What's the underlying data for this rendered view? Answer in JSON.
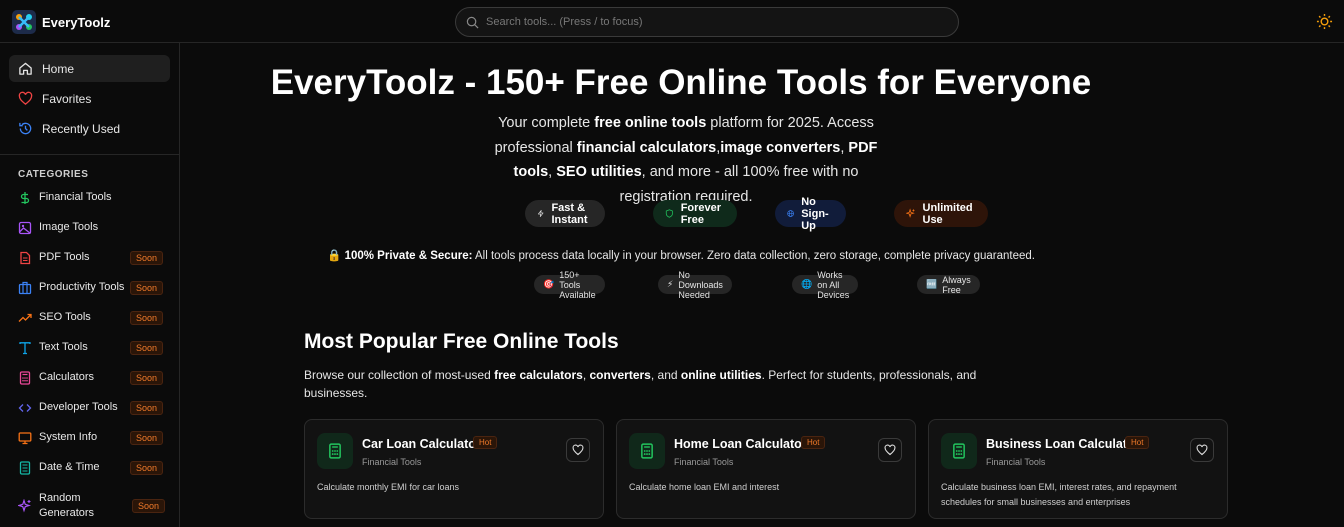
{
  "app": {
    "brand": "EveryToolz"
  },
  "search": {
    "placeholder": "Search tools... (Press / to focus)"
  },
  "sidebar": {
    "nav": [
      {
        "label": "Home",
        "icon": "home-icon"
      },
      {
        "label": "Favorites",
        "icon": "heart-icon"
      },
      {
        "label": "Recently Used",
        "icon": "history-icon"
      }
    ],
    "categories_title": "CATEGORIES",
    "soon_label": "Soon",
    "categories": [
      {
        "label": "Financial Tools",
        "icon": "dollar-icon",
        "color": "#22c55e",
        "soon": false
      },
      {
        "label": "Image Tools",
        "icon": "image-icon",
        "color": "#a855f7",
        "soon": false
      },
      {
        "label": "PDF Tools",
        "icon": "file-icon",
        "color": "#ef4444",
        "soon": true
      },
      {
        "label": "Productivity Tools",
        "icon": "briefcase-icon",
        "color": "#3b82f6",
        "soon": true
      },
      {
        "label": "SEO Tools",
        "icon": "trending-icon",
        "color": "#f97316",
        "soon": true
      },
      {
        "label": "Text Tools",
        "icon": "text-icon",
        "color": "#0ea5e9",
        "soon": true
      },
      {
        "label": "Calculators",
        "icon": "calculator-icon",
        "color": "#ec4899",
        "soon": true
      },
      {
        "label": "Developer Tools",
        "icon": "code-icon",
        "color": "#6366f1",
        "soon": true
      },
      {
        "label": "System Info",
        "icon": "monitor-icon",
        "color": "#f97316",
        "soon": true
      },
      {
        "label": "Date & Time",
        "icon": "calendar-icon",
        "color": "#14b8a6",
        "soon": true
      },
      {
        "label": "Random Generators",
        "icon": "sparkle-icon",
        "color": "#a855f7",
        "soon": true
      }
    ]
  },
  "hero": {
    "title": "EveryToolz - 150+ Free Online Tools for Everyone",
    "sub": {
      "p1": "Your complete ",
      "b1": "free online tools",
      "p2": " platform for 2025. Access professional ",
      "b2": "financial calculators",
      "p3": ",",
      "b3": "image converters",
      "p4": ", ",
      "b4": "PDF tools",
      "p5": ", ",
      "b5": "SEO utilities",
      "p6": ", and more - all 100% free with no registration required."
    },
    "pills": [
      {
        "label": "Fast & Instant",
        "icon": "zap-icon",
        "bg": "#262626",
        "color": "#e5e5e5"
      },
      {
        "label": "Forever Free",
        "icon": "shield-icon",
        "bg": "#0f2a1b",
        "color": "#22c55e"
      },
      {
        "label": "No Sign-Up",
        "icon": "globe-icon",
        "bg": "#111c3a",
        "color": "#3b82f6"
      },
      {
        "label": "Unlimited Use",
        "icon": "sparkle-icon",
        "bg": "#2e1409",
        "color": "#f97316"
      }
    ],
    "privacy_bold": "100% Private & Secure:",
    "privacy_text": " All tools process data locally in your browser. Zero data collection, zero storage, complete privacy guaranteed.",
    "badges": [
      {
        "emoji": "🎯",
        "label": "150+ Tools Available"
      },
      {
        "emoji": "⚡",
        "label": "No Downloads Needed"
      },
      {
        "emoji": "🌐",
        "label": "Works on All Devices"
      },
      {
        "emoji": "🆓",
        "label": "Always Free"
      }
    ]
  },
  "popular": {
    "title": "Most Popular Free Online Tools",
    "desc": {
      "p1": "Browse our collection of most-used ",
      "b1": "free calculators",
      "p2": ", ",
      "b2": "converters",
      "p3": ", and ",
      "b3": "online utilities",
      "p4": ". Perfect for students, professionals, and businesses."
    },
    "hot_label": "Hot",
    "cards": [
      {
        "title": "Car Loan Calculator",
        "category": "Financial Tools",
        "desc": "Calculate monthly EMI for car loans"
      },
      {
        "title": "Home Loan Calculator",
        "category": "Financial Tools",
        "desc": "Calculate home loan EMI and interest"
      },
      {
        "title": "Business Loan Calculator",
        "category": "Financial Tools",
        "desc": "Calculate business loan EMI, interest rates, and repayment schedules for small businesses and enterprises"
      }
    ]
  }
}
